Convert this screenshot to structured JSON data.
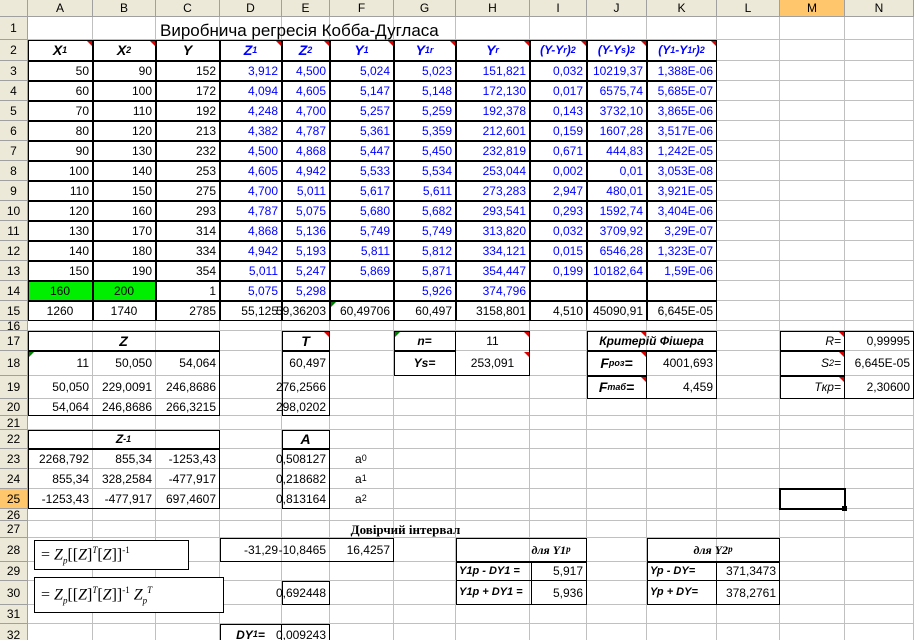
{
  "columns": [
    "A",
    "B",
    "C",
    "D",
    "E",
    "F",
    "G",
    "H",
    "I",
    "J",
    "K",
    "L",
    "M",
    "N"
  ],
  "rows": [
    "1",
    "2",
    "3",
    "4",
    "5",
    "6",
    "7",
    "8",
    "9",
    "10",
    "11",
    "12",
    "13",
    "14",
    "15",
    "16",
    "17",
    "18",
    "19",
    "20",
    "21",
    "22",
    "23",
    "24",
    "25",
    "26",
    "27",
    "28",
    "29",
    "30",
    "31",
    "32"
  ],
  "title": "Виробнича регресія Кобба-Дугласа",
  "headers": {
    "A": {
      "base": "X",
      "sub": "1"
    },
    "B": {
      "base": "X",
      "sub": "2"
    },
    "C": {
      "base": "Y"
    },
    "D": {
      "base": "Z",
      "sub": "1"
    },
    "E": {
      "base": "Z",
      "sub": "2"
    },
    "F": {
      "base": "Y",
      "sub": "1"
    },
    "G": {
      "base": "Y",
      "sub": "1r"
    },
    "H": {
      "base": "Y",
      "sub": "r"
    },
    "I": {
      "text": "(Y-Y",
      "sub": "r",
      "post": ")",
      "sup": "2"
    },
    "J": {
      "text": "(Y-Y",
      "sub": "s",
      "post": ")",
      "sup": "2"
    },
    "K": {
      "text": "(Y",
      "sub": "1",
      "mid": "-Y",
      "sub2": "1r",
      "post": ")",
      "sup": "2"
    }
  },
  "table": [
    [
      "50",
      "90",
      "152",
      "3,912",
      "4,500",
      "5,024",
      "5,023",
      "151,821",
      "0,032",
      "10219,37",
      "1,388E-06"
    ],
    [
      "60",
      "100",
      "172",
      "4,094",
      "4,605",
      "5,147",
      "5,148",
      "172,130",
      "0,017",
      "6575,74",
      "5,685E-07"
    ],
    [
      "70",
      "110",
      "192",
      "4,248",
      "4,700",
      "5,257",
      "5,259",
      "192,378",
      "0,143",
      "3732,10",
      "3,865E-06"
    ],
    [
      "80",
      "120",
      "213",
      "4,382",
      "4,787",
      "5,361",
      "5,359",
      "212,601",
      "0,159",
      "1607,28",
      "3,517E-06"
    ],
    [
      "90",
      "130",
      "232",
      "4,500",
      "4,868",
      "5,447",
      "5,450",
      "232,819",
      "0,671",
      "444,83",
      "1,242E-05"
    ],
    [
      "100",
      "140",
      "253",
      "4,605",
      "4,942",
      "5,533",
      "5,534",
      "253,044",
      "0,002",
      "0,01",
      "3,053E-08"
    ],
    [
      "110",
      "150",
      "275",
      "4,700",
      "5,011",
      "5,617",
      "5,611",
      "273,283",
      "2,947",
      "480,01",
      "3,921E-05"
    ],
    [
      "120",
      "160",
      "293",
      "4,787",
      "5,075",
      "5,680",
      "5,682",
      "293,541",
      "0,293",
      "1592,74",
      "3,404E-06"
    ],
    [
      "130",
      "170",
      "314",
      "4,868",
      "5,136",
      "5,749",
      "5,749",
      "313,820",
      "0,032",
      "3709,92",
      "3,29E-07"
    ],
    [
      "140",
      "180",
      "334",
      "4,942",
      "5,193",
      "5,811",
      "5,812",
      "334,121",
      "0,015",
      "6546,28",
      "1,323E-07"
    ],
    [
      "150",
      "190",
      "354",
      "5,011",
      "5,247",
      "5,869",
      "5,871",
      "354,447",
      "0,199",
      "10182,64",
      "1,59E-06"
    ]
  ],
  "row14": [
    "160",
    "200",
    "1",
    "5,075",
    "5,298",
    "",
    "5,926",
    "374,796",
    "",
    "",
    ""
  ],
  "row15": [
    "1260",
    "1740",
    "2785",
    "55,125",
    "59,36203",
    "60,49706",
    "60,497",
    "3158,801",
    "4,510",
    "45090,91",
    "6,645E-05"
  ],
  "z": {
    "label": "Z",
    "rows": [
      [
        "11",
        "50,050",
        "54,064"
      ],
      [
        "50,050",
        "229,0091",
        "246,8686"
      ],
      [
        "54,064",
        "246,8686",
        "266,3215"
      ]
    ]
  },
  "zinv": {
    "label": "Z",
    "sup": "-1",
    "rows": [
      [
        "2268,792",
        "855,34",
        "-1253,43"
      ],
      [
        "855,34",
        "328,2584",
        "-477,917"
      ],
      [
        "-1253,43",
        "-477,917",
        "697,4607"
      ]
    ]
  },
  "t": {
    "label": "T",
    "values": [
      "60,497",
      "276,2566",
      "298,0202"
    ]
  },
  "a": {
    "label": "A",
    "values": [
      "0,508127",
      "0,218682",
      "0,813164"
    ],
    "coef": [
      "a",
      "a",
      "a"
    ],
    "coef_sub": [
      "0",
      "1",
      "2"
    ]
  },
  "n": {
    "label": "n=",
    "value": "11"
  },
  "ys": {
    "label": "Ys=",
    "value": "253,091"
  },
  "fisher": {
    "title": "Критерій Фішера",
    "froz_label": "F",
    "froz_sub": "роз",
    "froz_eq": "=",
    "froz": "4001,693",
    "ftab_label": "F",
    "ftab_sub": "таб",
    "ftab_eq": "=",
    "ftab": "4,459"
  },
  "stats": {
    "r_label": "R=",
    "r": "0,99995",
    "s_label": "S",
    "s_sup": "2",
    "s_eq": "=",
    "s": "6,645E-05",
    "t_label": "Tкр=",
    "t": "2,30600"
  },
  "interval": {
    "title": "Довірчий інтервал",
    "row28": [
      "-31,29",
      "-10,8465",
      "16,4257"
    ],
    "e30": "0,692448",
    "dy_label": "DY",
    "dy_sub": "1",
    "dy_eq": " =",
    "dy": "0,009243"
  },
  "formula1": "= Z_p[[Z]^T [Z]]^-1",
  "formula2": "= Z_p[[Z]^T [Z]]^-1 Z_p^T",
  "y1": {
    "title": "для Y1",
    "title_sub": "p",
    "minus_label": "Y1p - DY1 =",
    "minus": "5,917",
    "plus_label": "Y1p + DY1 =",
    "plus": "5,936"
  },
  "y2": {
    "title": "для Y2",
    "title_sub": "p",
    "minus_label": "Yp - DY=",
    "minus": "371,3473",
    "plus_label": "Yp + DY=",
    "plus": "378,2761"
  },
  "selected_cell": "M25",
  "colors": {
    "header_bg": "#ece9d8",
    "selected_header": "#ffc66b",
    "green_fill": "#00ee00",
    "blue_text": "#0000ff",
    "comment_marker": "#e00000"
  }
}
